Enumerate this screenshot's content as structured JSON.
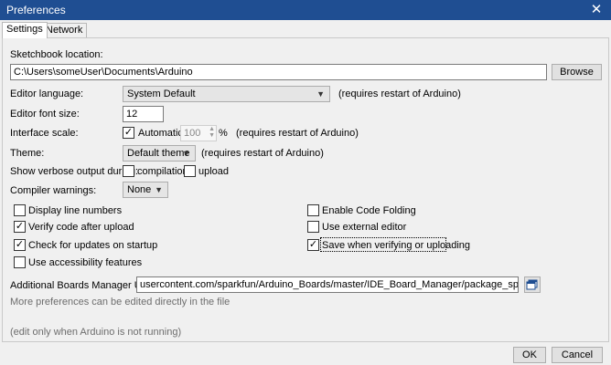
{
  "window": {
    "title": "Preferences",
    "close_glyph": "✕"
  },
  "tabs": [
    {
      "label": "Settings",
      "active": true
    },
    {
      "label": "Network",
      "active": false
    }
  ],
  "sketchbook": {
    "label": "Sketchbook location:",
    "value": "C:\\Users\\someUser\\Documents\\Arduino",
    "browse_label": "Browse"
  },
  "editor_language": {
    "label": "Editor language:",
    "value": "System Default",
    "note": "(requires restart of Arduino)"
  },
  "editor_font_size": {
    "label": "Editor font size:",
    "value": "12"
  },
  "interface_scale": {
    "label": "Interface scale:",
    "automatic_label": "Automatic",
    "automatic_checked": true,
    "value": "100",
    "unit": "%",
    "note": "(requires restart of Arduino)"
  },
  "theme": {
    "label": "Theme:",
    "value": "Default theme",
    "note": "(requires restart of Arduino)"
  },
  "verbose": {
    "label": "Show verbose output during:",
    "compilation_label": "compilation",
    "compilation_checked": false,
    "upload_label": "upload",
    "upload_checked": false
  },
  "compiler_warnings": {
    "label": "Compiler warnings:",
    "value": "None"
  },
  "options_left": [
    {
      "label": "Display line numbers",
      "checked": false
    },
    {
      "label": "Verify code after upload",
      "checked": true
    },
    {
      "label": "Check for updates on startup",
      "checked": true
    },
    {
      "label": "Use accessibility features",
      "checked": false
    }
  ],
  "options_right": [
    {
      "label": "Enable Code Folding",
      "checked": false
    },
    {
      "label": "Use external editor",
      "checked": false
    },
    {
      "label": "Save when verifying or uploading",
      "checked": true
    }
  ],
  "boards_manager": {
    "label": "Additional Boards Manager URLs:",
    "value": "usercontent.com/sparkfun/Arduino_Boards/master/IDE_Board_Manager/package_sparkfun_index.json"
  },
  "notes": {
    "more_prefs": "More preferences can be edited directly in the file",
    "edit_only": "(edit only when Arduino is not running)"
  },
  "footer": {
    "ok_label": "OK",
    "cancel_label": "Cancel"
  },
  "icons": {
    "check": "✓",
    "dropdown": "chevron-down-icon",
    "window_list": "window-list-icon"
  },
  "colors": {
    "titlebar": "#1f4e92",
    "panel": "#f0f0f0"
  }
}
